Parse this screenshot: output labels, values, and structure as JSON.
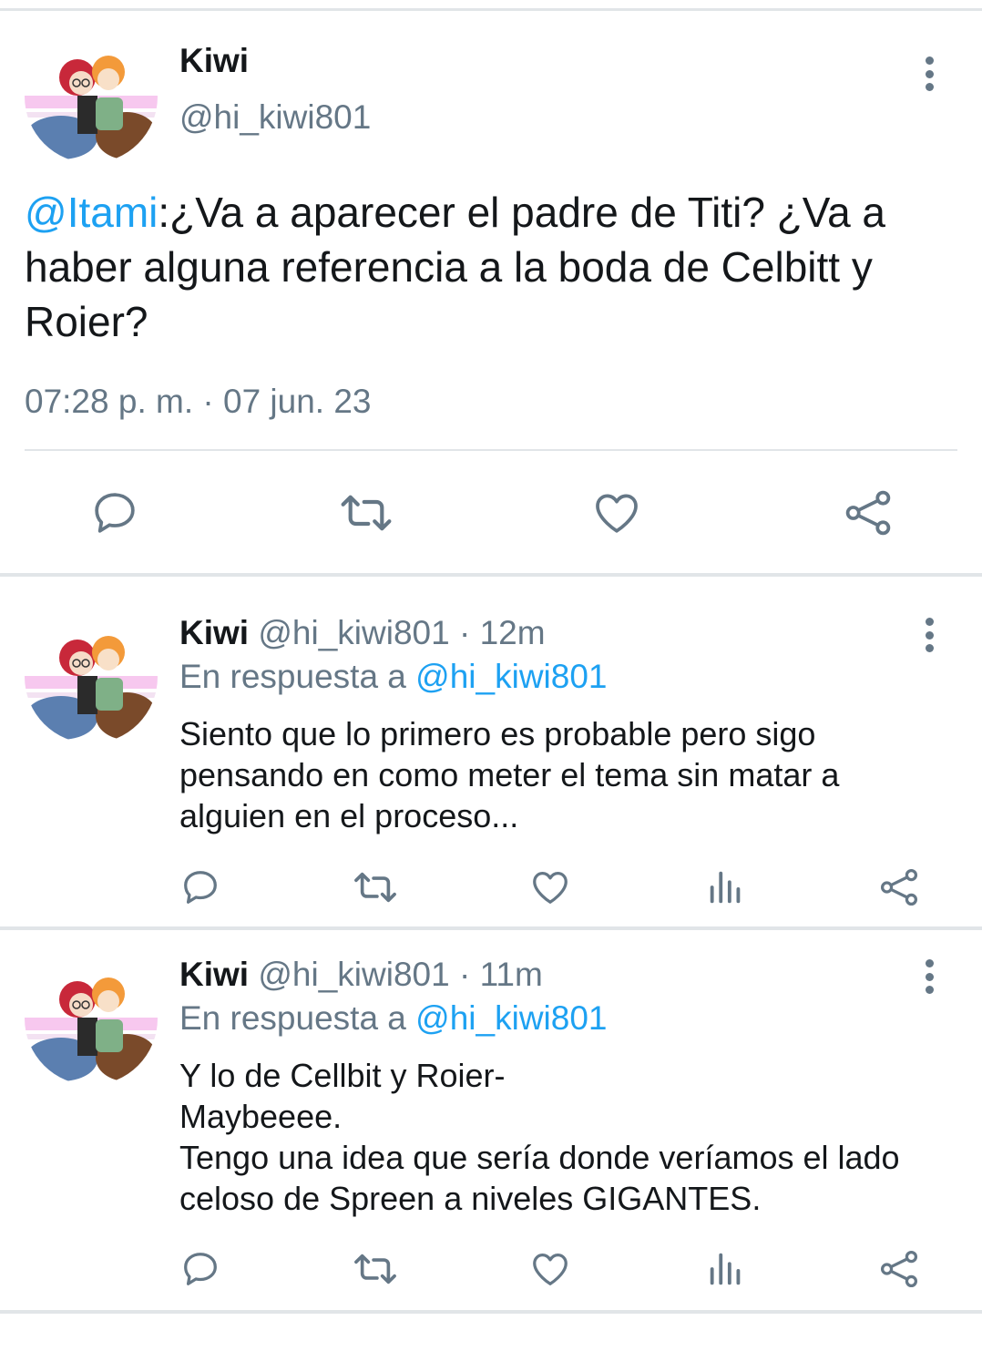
{
  "main_tweet": {
    "display_name": "Kiwi",
    "handle": "@hi_kiwi801",
    "mention": "@Itami",
    "text": ":¿Va a aparecer el padre de Titi? ¿Va a haber alguna referencia a la boda de Celbitt y Roier?",
    "timestamp": "07:28 p. m. · 07 jun. 23",
    "actions": [
      "reply-icon",
      "retweet-icon",
      "like-icon",
      "share-icon"
    ]
  },
  "replies": [
    {
      "display_name": "Kiwi",
      "handle": "@hi_kiwi801",
      "separator": "·",
      "time": "12m",
      "reply_to_label": "En respuesta a",
      "reply_to_handle": "@hi_kiwi801",
      "text": "Siento que lo primero es probable pero sigo pensando en como meter el tema sin matar a alguien en el proceso...",
      "actions": [
        "reply-icon",
        "retweet-icon",
        "like-icon",
        "analytics-icon",
        "share-icon"
      ]
    },
    {
      "display_name": "Kiwi",
      "handle": "@hi_kiwi801",
      "separator": "·",
      "time": "11m",
      "reply_to_label": "En respuesta a",
      "reply_to_handle": "@hi_kiwi801",
      "text": "Y lo de Cellbit y Roier-\nMaybeeee.\nTengo una idea que sería donde veríamos el lado celoso de Spreen a niveles GIGANTES.",
      "actions": [
        "reply-icon",
        "retweet-icon",
        "like-icon",
        "analytics-icon",
        "share-icon"
      ]
    }
  ],
  "colors": {
    "accent": "#1da1f2",
    "muted": "#657786",
    "text": "#14171a",
    "divider": "#e1e5e8"
  }
}
